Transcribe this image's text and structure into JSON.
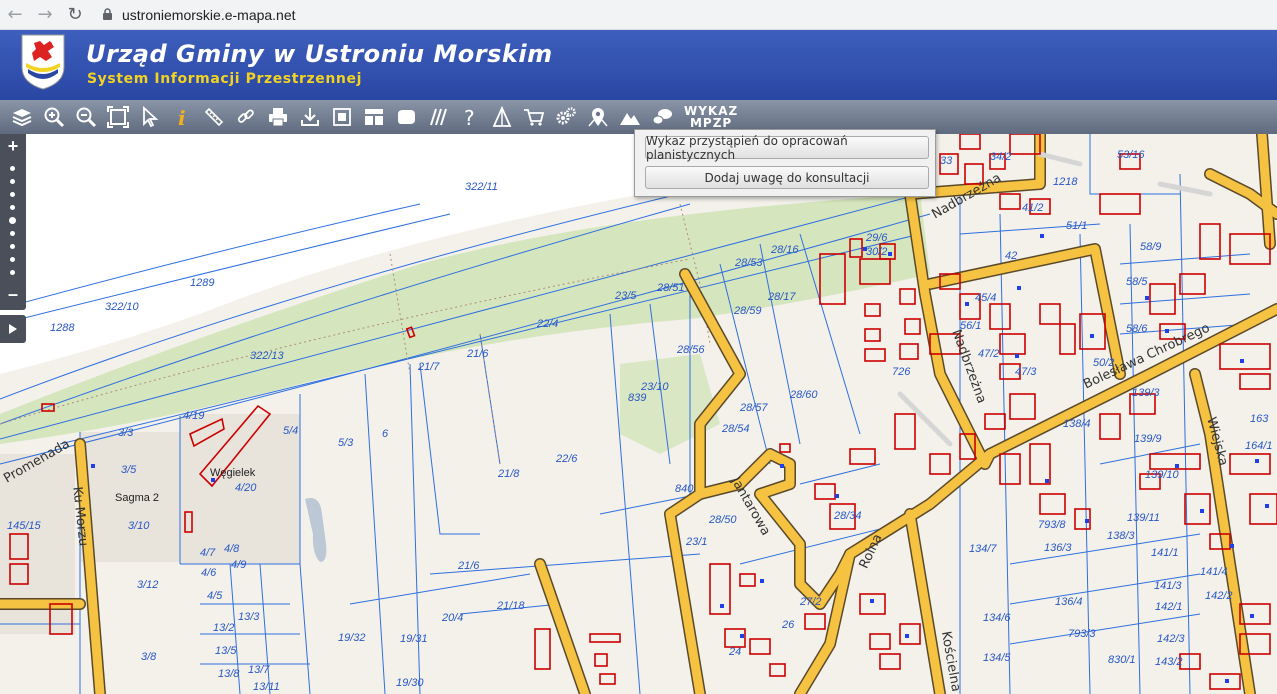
{
  "browser": {
    "url": "ustroniemorskie.e-mapa.net"
  },
  "header": {
    "title": "Urząd Gminy w Ustroniu Morskim",
    "subtitle": "System Informacji Przestrzennej"
  },
  "toolbar": {
    "wykaz_line1": "WYKAZ",
    "wykaz_line2": "MPZP"
  },
  "dropdown": {
    "item1": "Wykaz przystąpień do opracowań planistycznych",
    "item2": "Dodaj uwagę do konsultacji"
  },
  "zoom": {
    "plus": "+",
    "minus": "–"
  },
  "map": {
    "streets": [
      "Nadbrzeżna",
      "Nadbrzeżna",
      "Bolesława Chrobrego",
      "Wiejska",
      "Jantarowa",
      "Rolna",
      "Kościelna",
      "Ku Morzu",
      "Promenada"
    ],
    "places": [
      "Węgielek",
      "Sagma 2"
    ],
    "parcels": [
      "322/11",
      "1289",
      "322/10",
      "1288",
      "322/13",
      "22/4",
      "23/5",
      "28/51",
      "28/53",
      "28/16",
      "28/17",
      "28/59",
      "28/56",
      "28/60",
      "23/10",
      "839",
      "28/57",
      "28/54",
      "21/7",
      "21/6",
      "21/8",
      "22/6",
      "21/6",
      "20/4",
      "21/18",
      "19/32",
      "19/31",
      "19/30",
      "4/19",
      "5/4",
      "5/3",
      "6",
      "3/3",
      "3/5",
      "3/10",
      "3/12",
      "3/8",
      "4/20",
      "4/7",
      "4/8",
      "4/9",
      "4/6",
      "4/5",
      "13/3",
      "13/2",
      "13/5",
      "13/7",
      "13/8",
      "13/11",
      "145/15",
      "840",
      "23/1",
      "28/50",
      "28/34",
      "726",
      "47/2",
      "47/3",
      "45/4",
      "56/1",
      "41/2",
      "42",
      "51/1",
      "58/9",
      "58/5",
      "58/6",
      "50/2",
      "139/3",
      "139/9",
      "139/10",
      "139/11",
      "141/1",
      "141/3",
      "141/4",
      "142/1",
      "142/3",
      "142/2",
      "143/2",
      "163",
      "164/1",
      "138/4",
      "138/3",
      "136/3",
      "136/4",
      "134/7",
      "134/6",
      "134/5",
      "793/8",
      "793/3",
      "830/1",
      "29/6",
      "30/2",
      "1218",
      "53/16",
      "24",
      "26",
      "27/2",
      "33",
      "34/2"
    ]
  },
  "colors": {
    "header_top": "#3e5fbd",
    "header_subtitle": "#f2d321",
    "parcel_line": "#2f6fe0",
    "building": "#cc0000",
    "road": "#f5c242",
    "green": "#cfe3b5"
  },
  "icons": [
    "layers-icon",
    "zoom-in-icon",
    "zoom-out-icon",
    "full-extent-icon",
    "pointer-icon",
    "info-icon",
    "measure-icon",
    "link-icon",
    "print-icon",
    "download-icon",
    "overview-icon",
    "layout-icon",
    "annotation-icon",
    "hatch-icon",
    "help-icon",
    "sunlight-icon",
    "cart-icon",
    "settings-icon",
    "place-icon",
    "terrain-icon",
    "comment-icon"
  ]
}
